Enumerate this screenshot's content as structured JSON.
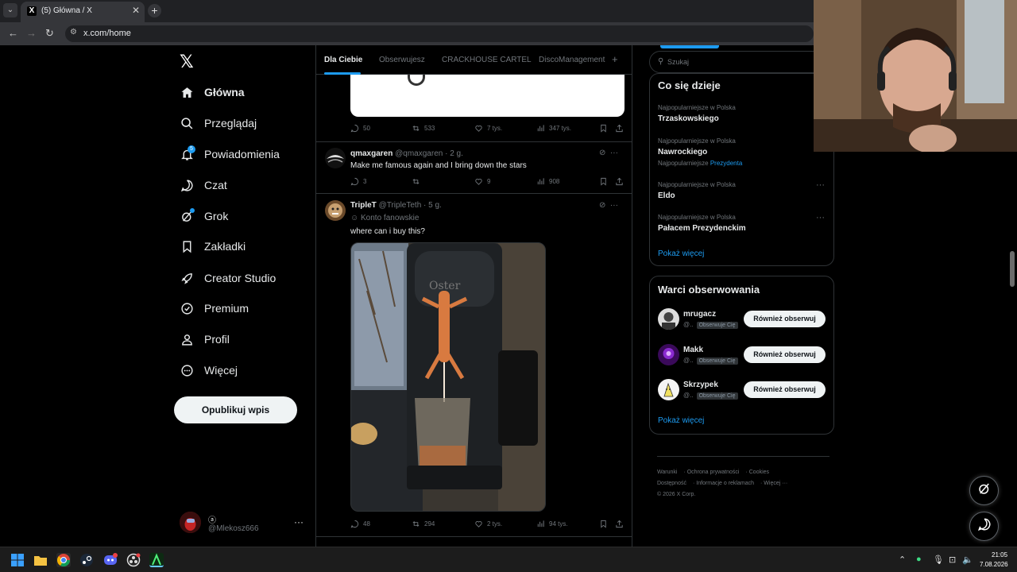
{
  "browser": {
    "tab_title": "(5) Główna / X",
    "tab_close": "✕",
    "new_tab": "+",
    "url": "x.com/home",
    "back": "←",
    "forward": "→",
    "reload": "↻"
  },
  "nav": {
    "logo": "𝕏",
    "items": [
      {
        "label": "Główna"
      },
      {
        "label": "Przeglądaj"
      },
      {
        "label": "Powiadomienia",
        "badge": "5"
      },
      {
        "label": "Czat"
      },
      {
        "label": "Grok"
      },
      {
        "label": "Zakładki"
      },
      {
        "label": "Creator Studio"
      },
      {
        "label": "Premium"
      },
      {
        "label": "Profil"
      },
      {
        "label": "Więcej"
      }
    ],
    "post_button": "Opublikuj wpis",
    "account": {
      "name": "ⓐ",
      "handle": "@Mlekosz666",
      "more": "···"
    }
  },
  "feed": {
    "tabs": [
      "Dla Ciebie",
      "Obserwujesz",
      "CRACKHOUSE CARTEL",
      "DiscoManagement"
    ],
    "plus": "+",
    "post0_actions": {
      "replies": "50",
      "reposts": "533",
      "likes": "7 tys.",
      "views": "347 tys."
    },
    "post1": {
      "name": "qmaxgaren",
      "meta": "@qmaxgaren · 2 g.",
      "text": "Make me famous again and I bring down the stars",
      "actions": {
        "replies": "3",
        "reposts": "",
        "likes": "9",
        "views": "908"
      }
    },
    "post2": {
      "name": "TripleT",
      "meta": "@TripleTeth · 5 g.",
      "fan": "Konto fanowskie",
      "text": "where can i buy this?",
      "actions": {
        "replies": "48",
        "reposts": "294",
        "likes": "2 tys.",
        "views": "94 tys."
      }
    },
    "more_icon": "···"
  },
  "right": {
    "search_placeholder": "Szukaj",
    "trends_title": "Co się dzieje",
    "trends": [
      {
        "sub": "Najpopularniejsze w Polska",
        "name": "Trzaskowskiego"
      },
      {
        "sub": "Najpopularniejsze w Polska",
        "name": "Nawrockiego",
        "extra_prefix": "Najpopularniejsze ",
        "extra_hl": "Prezydenta"
      },
      {
        "sub": "Najpopularniejsze w Polska",
        "name": "Eldo"
      },
      {
        "sub": "Najpopularniejsze w Polska",
        "name": "Pałacem Prezydenckim"
      }
    ],
    "show_more": "Pokaż więcej",
    "follow_title": "Warci obserwowania",
    "follow": [
      {
        "name": "mrugacz",
        "handle": "@..",
        "tag": "Obserwuje Cię",
        "button": "Również obserwuj"
      },
      {
        "name": "Makk",
        "handle": "@..",
        "tag": "Obserwuje Cię",
        "button": "Również obserwuj"
      },
      {
        "name": "Skrzypek",
        "handle": "@..",
        "tag": "Obserwuje Cię",
        "button": "Również obserwuj"
      }
    ],
    "footer_line1": [
      "Warunki",
      "Ochrona prywatności",
      "Cookies"
    ],
    "footer_line2": [
      "Dostępność",
      "Informacje o reklamach",
      "Więcej ···"
    ],
    "copyright": "© 2026 X Corp."
  },
  "taskbar": {
    "time": "21:05",
    "date": "7.08.2026"
  },
  "colors": {
    "accent": "#1d9bf0",
    "background": "#000000",
    "border": "#2f3336"
  }
}
